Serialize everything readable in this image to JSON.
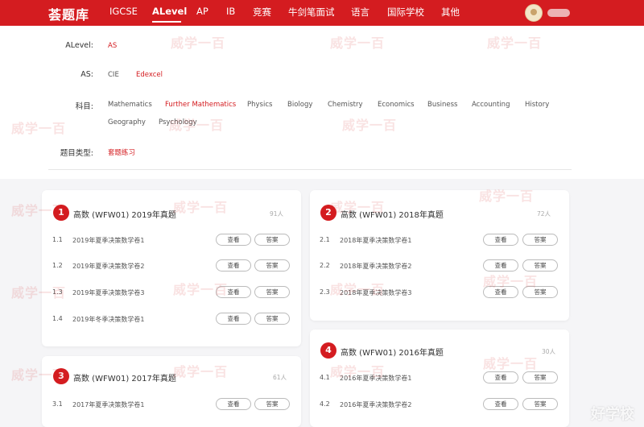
{
  "header": {
    "logo": "荟题库",
    "nav": [
      "IGCSE",
      "ALevel",
      "AP",
      "IB",
      "竞赛",
      "牛剑笔面试",
      "语言",
      "国际学校",
      "其他"
    ],
    "active_nav": "ALevel"
  },
  "filters": {
    "alevel": {
      "label": "ALevel:",
      "value": "AS"
    },
    "as": {
      "label": "AS:",
      "options": [
        "CIE",
        "Edexcel"
      ],
      "selected": "Edexcel"
    },
    "subject": {
      "label": "科目:",
      "options": [
        "Mathematics",
        "Further Mathematics",
        "Physics",
        "Biology",
        "Chemistry",
        "Economics",
        "Business",
        "Accounting",
        "History",
        "Geography",
        "Psychology"
      ],
      "selected": "Further Mathematics"
    },
    "type": {
      "label": "题目类型:",
      "value": "套题练习"
    }
  },
  "cards": [
    {
      "num": "1",
      "title": "高数 (WFW01) 2019年真题",
      "views": "91人",
      "rows": [
        {
          "num": "1.1",
          "text": "2019年夏季决策数学卷1"
        },
        {
          "num": "1.2",
          "text": "2019年夏季决策数学卷2"
        },
        {
          "num": "1.3",
          "text": "2019年夏季决策数学卷3"
        },
        {
          "num": "1.4",
          "text": "2019年冬季决策数学卷1"
        }
      ]
    },
    {
      "num": "2",
      "title": "高数 (WFW01) 2018年真题",
      "views": "72人",
      "rows": [
        {
          "num": "2.1",
          "text": "2018年夏季决策数学卷1"
        },
        {
          "num": "2.2",
          "text": "2018年夏季决策数学卷2"
        },
        {
          "num": "2.3",
          "text": "2018年夏季决策数学卷3"
        }
      ]
    },
    {
      "num": "3",
      "title": "高数 (WFW01) 2017年真题",
      "views": "61人",
      "rows": [
        {
          "num": "3.1",
          "text": "2017年夏季决策数学卷1"
        }
      ]
    },
    {
      "num": "4",
      "title": "高数 (WFW01) 2016年真题",
      "views": "30人",
      "rows": [
        {
          "num": "4.1",
          "text": "2016年夏季决策数学卷1"
        },
        {
          "num": "4.2",
          "text": "2016年夏季决策数学卷2"
        }
      ]
    }
  ],
  "buttons": {
    "view": "查看",
    "answer": "答案"
  },
  "watermark": {
    "text": "威学一百",
    "corner": "好学校"
  },
  "colors": {
    "brand": "#d41c20",
    "background": "#f5f5f7"
  }
}
